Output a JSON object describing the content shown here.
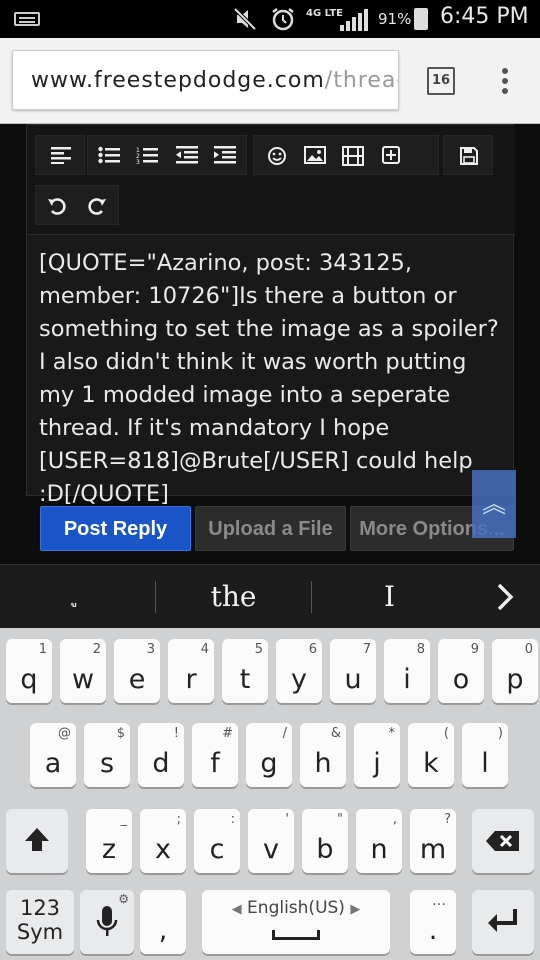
{
  "status_bar": {
    "battery_percent": "91%",
    "time": "6:45 PM",
    "network": "4G LTE"
  },
  "browser": {
    "url_host": "www.freestepdodge.com",
    "url_path": "/threads",
    "tab_count": "16"
  },
  "editor": {
    "toolbar_icons": [
      "align-left-icon",
      "bullet-list-icon",
      "numbered-list-icon",
      "outdent-icon",
      "indent-icon",
      "smiley-icon",
      "image-icon",
      "media-icon",
      "insert-icon",
      "save-draft-icon",
      "undo-icon",
      "redo-icon"
    ],
    "content": "[QUOTE=\"Azarino, post: 343125, member: 10726\"]Is there a button or something to set the image as a spoiler? I also didn't think it was worth putting my 1 modded image into a seperate thread. If it's mandatory I hope [USER=818]@Brute[/USER] could help :D[/QUOTE]"
  },
  "actions": {
    "post_reply": "Post Reply",
    "upload_file": "Upload a File",
    "more_options": "More Options..."
  },
  "suggestions": {
    "left": "ู",
    "middle": "the",
    "right": "I"
  },
  "keyboard": {
    "row1": [
      {
        "k": "q",
        "h": "1"
      },
      {
        "k": "w",
        "h": "2"
      },
      {
        "k": "e",
        "h": "3"
      },
      {
        "k": "r",
        "h": "4"
      },
      {
        "k": "t",
        "h": "5"
      },
      {
        "k": "y",
        "h": "6"
      },
      {
        "k": "u",
        "h": "7"
      },
      {
        "k": "i",
        "h": "8"
      },
      {
        "k": "o",
        "h": "9"
      },
      {
        "k": "p",
        "h": "0"
      }
    ],
    "row2": [
      {
        "k": "a",
        "h": "@"
      },
      {
        "k": "s",
        "h": "$"
      },
      {
        "k": "d",
        "h": "!"
      },
      {
        "k": "f",
        "h": "#"
      },
      {
        "k": "g",
        "h": "/"
      },
      {
        "k": "h",
        "h": "&"
      },
      {
        "k": "j",
        "h": "*"
      },
      {
        "k": "k",
        "h": "("
      },
      {
        "k": "l",
        "h": ")"
      }
    ],
    "row3": [
      {
        "k": "z",
        "h": "_"
      },
      {
        "k": "x",
        "h": ";"
      },
      {
        "k": "c",
        "h": ":"
      },
      {
        "k": "v",
        "h": "'"
      },
      {
        "k": "b",
        "h": "\""
      },
      {
        "k": "n",
        "h": ","
      },
      {
        "k": "m",
        "h": "?"
      }
    ],
    "sym_label_top": "123",
    "sym_label_bottom": "Sym",
    "comma": ",",
    "space_label": "English(US)",
    "period": "."
  }
}
